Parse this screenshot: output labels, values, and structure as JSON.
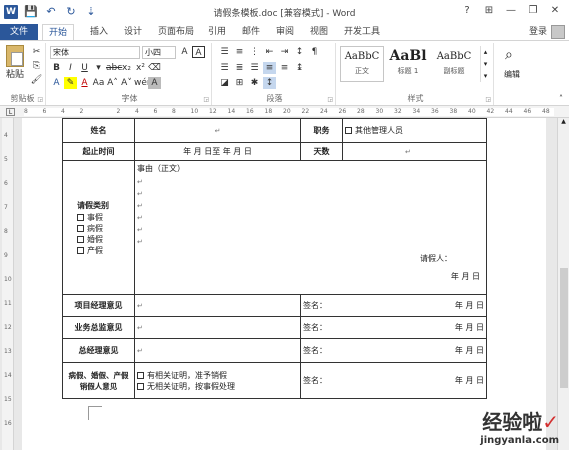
{
  "window": {
    "title": "请假条模板.doc [兼容模式] - Word",
    "controls": {
      "help": "?",
      "ribbon_display": "⊞",
      "minimize": "—",
      "restore": "❐",
      "close": "✕"
    }
  },
  "qat": {
    "save": "💾",
    "undo": "↶",
    "redo": "↻",
    "customize": "⇣"
  },
  "tabs": [
    "文件",
    "开始",
    "插入",
    "设计",
    "页面布局",
    "引用",
    "邮件",
    "审阅",
    "视图",
    "开发工具"
  ],
  "account": {
    "login": "登录"
  },
  "ribbon": {
    "clipboard": {
      "label": "剪贴板",
      "paste": "粘贴"
    },
    "font": {
      "label": "字体",
      "font_name": "宋体",
      "font_size": "小四",
      "wen": "wén",
      "A": "A"
    },
    "paragraph": {
      "label": "段落"
    },
    "styles": {
      "label": "样式",
      "items": [
        {
          "sample": "AaBbC",
          "name": "正文"
        },
        {
          "sample": "AaBl",
          "name": "标题 1"
        },
        {
          "sample": "AaBbC",
          "name": "副标题"
        }
      ]
    },
    "editing": {
      "label": "编辑"
    }
  },
  "ruler": {
    "numbers": [
      "8",
      "6",
      "4",
      "2",
      "",
      "2",
      "4",
      "6",
      "8",
      "10",
      "12",
      "14",
      "16",
      "18",
      "20",
      "22",
      "24",
      "26",
      "28",
      "30",
      "32",
      "34",
      "36",
      "38",
      "40",
      "42",
      "44",
      "46",
      "48"
    ]
  },
  "vruler": {
    "numbers": [
      "4",
      "5",
      "6",
      "7",
      "8",
      "9",
      "10",
      "11",
      "12",
      "13",
      "14",
      "15",
      "16"
    ]
  },
  "form": {
    "row_name": {
      "label": "姓名",
      "dept_label": "职务",
      "checkbox": "其他管理人员"
    },
    "row_period": {
      "label": "起止时间",
      "value": "年   月   日至   年   月   日",
      "days_label": "天数"
    },
    "row_type": {
      "label": "请假类别",
      "options": [
        "事假",
        "病假",
        "婚假",
        "产假"
      ],
      "reason": "事由（正文）",
      "applicant": "请假人：",
      "date": "年   月   日"
    },
    "row_pm": {
      "label": "项目经理意见",
      "sign": "签名：",
      "date": "年   月   日"
    },
    "row_gm_biz": {
      "label": "业务总监意见",
      "sign": "签名：",
      "date": "年   月   日"
    },
    "row_gm": {
      "label": "总经理意见",
      "sign": "签名：",
      "date": "年   月   日"
    },
    "row_sick": {
      "label": "病假、婚假、产假销假人意见",
      "opt1": "有相关证明，准予销假",
      "opt2": "无相关证明，按事假处理",
      "sign": "签名：",
      "date": "年   月   日"
    }
  },
  "watermark": {
    "cn": "经验啦",
    "url": "jingyanla.com"
  }
}
